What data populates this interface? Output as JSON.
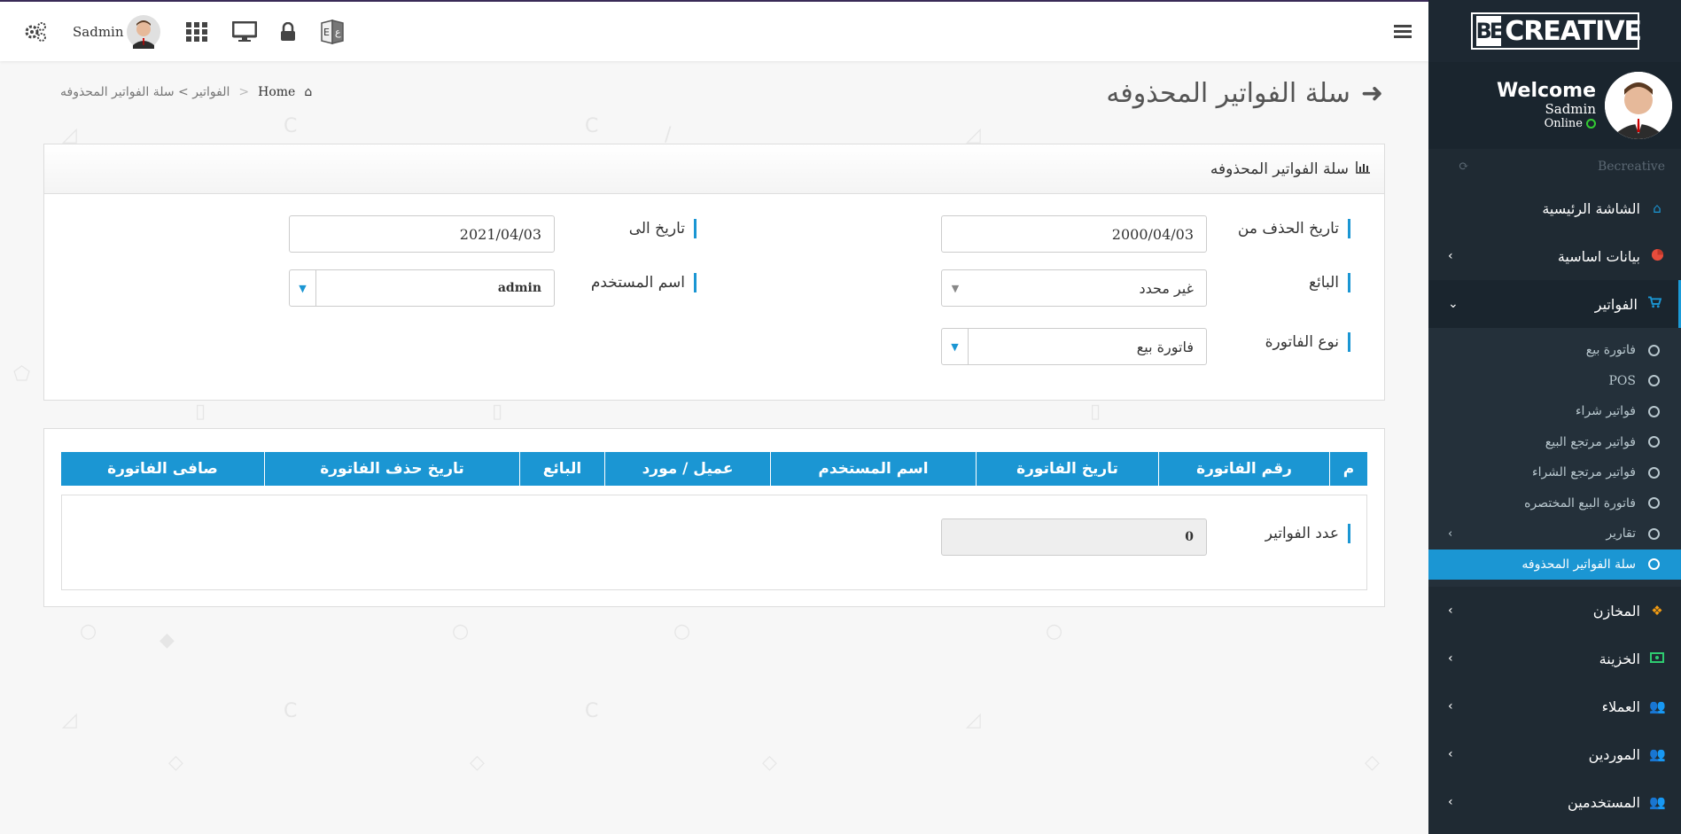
{
  "topbar": {
    "user_name": "Sadmin"
  },
  "sidebar": {
    "logo_mark": "BE",
    "logo_text": "CREATIVE",
    "welcome": "Welcome",
    "user_name": "Sadmin",
    "status": "Online",
    "brand": "Becreative",
    "menu": {
      "home": "الشاشة الرئيسية",
      "basic_data": "بيانات اساسية",
      "invoices": "الفواتير",
      "stores": "المخازن",
      "treasury": "الخزينة",
      "customers": "العملاء",
      "suppliers": "الموردين",
      "users": "المستخدمين"
    },
    "submenu": [
      "فاتورة بيع",
      "POS",
      "فواتير شراء",
      "فواتير مرتجع البيع",
      "فواتير مرتجع الشراء",
      "فاتورة البيع المختصره",
      "تقارير",
      "سلة الفواتير المحذوفه"
    ]
  },
  "page": {
    "title": "سلة الفواتير المحذوفه",
    "breadcrumb_home": "Home",
    "breadcrumb_sep": ">",
    "breadcrumb_path": "الفواتير > سلة الفواتير المحذوفه"
  },
  "filter_panel": {
    "heading": "سلة الفواتير المحذوفه",
    "date_from_label": "تاريخ الحذف من",
    "date_from_value": "2000/04/03",
    "date_to_label": "تاريخ الى",
    "date_to_value": "2021/04/03",
    "seller_label": "البائع",
    "seller_value": "غير محدد",
    "username_label": "اسم المستخدم",
    "username_value": "admin",
    "invoice_type_label": "نوع الفاتورة",
    "invoice_type_value": "فاتورة بيع"
  },
  "table": {
    "columns": [
      "م",
      "رقم الفاتورة",
      "تاريخ الفاتورة",
      "اسم المستخدم",
      "عميل / مورد",
      "البائع",
      "تاريخ حذف الفاتورة",
      "صافى الفاتورة"
    ],
    "count_label": "عدد الفواتير",
    "count_value": "0"
  },
  "colors": {
    "accent": "#1b96d3",
    "sidebar_bg": "#1f2a33"
  }
}
